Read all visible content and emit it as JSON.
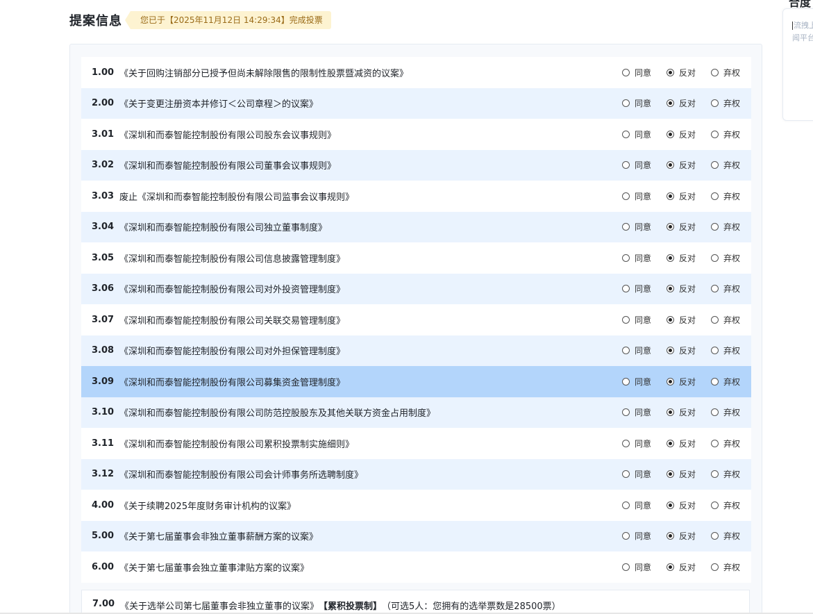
{
  "header": {
    "title": "提案信息",
    "vote_tag": "您已于【2025年11月12日 14:29:34】完成投票"
  },
  "options": [
    "同意",
    "反对",
    "弃权"
  ],
  "proposals": [
    {
      "num": "1.00",
      "text": "《关于回购注销部分已授予但尚未解除限售的限制性股票暨减资的议案》",
      "selected": 1
    },
    {
      "num": "2.00",
      "text": "《关于变更注册资本并修订＜公司章程＞的议案》",
      "selected": 1
    },
    {
      "num": "3.01",
      "text": "《深圳和而泰智能控制股份有限公司股东会议事规则》",
      "selected": 1
    },
    {
      "num": "3.02",
      "text": "《深圳和而泰智能控制股份有限公司董事会议事规则》",
      "selected": 1
    },
    {
      "num": "3.03",
      "text": "废止《深圳和而泰智能控制股份有限公司监事会议事规则》",
      "selected": 1
    },
    {
      "num": "3.04",
      "text": "《深圳和而泰智能控制股份有限公司独立董事制度》",
      "selected": 1
    },
    {
      "num": "3.05",
      "text": "《深圳和而泰智能控制股份有限公司信息披露管理制度》",
      "selected": 1
    },
    {
      "num": "3.06",
      "text": "《深圳和而泰智能控制股份有限公司对外投资管理制度》",
      "selected": 1
    },
    {
      "num": "3.07",
      "text": "《深圳和而泰智能控制股份有限公司关联交易管理制度》",
      "selected": 1
    },
    {
      "num": "3.08",
      "text": "《深圳和而泰智能控制股份有限公司对外担保管理制度》",
      "selected": 1
    },
    {
      "num": "3.09",
      "text": "《深圳和而泰智能控制股份有限公司募集资金管理制度》",
      "selected": 1
    },
    {
      "num": "3.10",
      "text": "《深圳和而泰智能控制股份有限公司防范控股股东及其他关联方资金占用制度》",
      "selected": 1
    },
    {
      "num": "3.11",
      "text": "《深圳和而泰智能控制股份有限公司累积投票制实施细则》",
      "selected": 1
    },
    {
      "num": "3.12",
      "text": "《深圳和而泰智能控制股份有限公司会计师事务所选聘制度》",
      "selected": 1
    },
    {
      "num": "4.00",
      "text": "《关于续聘2025年度财务审计机构的议案》",
      "selected": 1
    },
    {
      "num": "5.00",
      "text": "《关于第七届董事会非独立董事薪酬方案的议案》",
      "selected": 1
    },
    {
      "num": "6.00",
      "text": "《关于第七届董事会独立董事津贴方案的议案》",
      "selected": 1
    }
  ],
  "row7": {
    "num": "7.00",
    "text": "《关于选举公司第七届董事会非独立董事的议案》",
    "tag": "【累积投票制】",
    "note": "（可选5人：您拥有的选举票数是28500票）"
  },
  "side": {
    "title": "合度",
    "input_line1": "流拽上",
    "input_line2": "闻平台"
  }
}
